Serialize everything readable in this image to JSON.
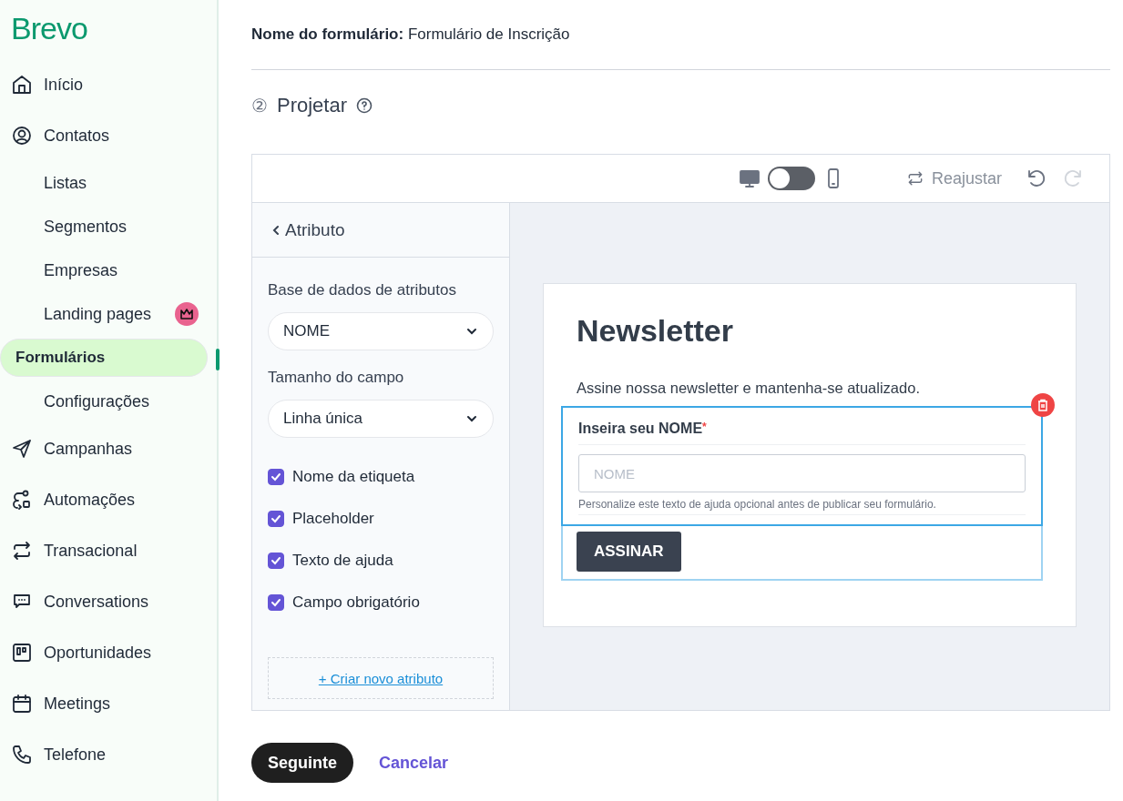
{
  "sidebar": {
    "logo": "Brevo",
    "items": [
      {
        "label": "Início",
        "kind": "home",
        "selected": false
      },
      {
        "label": "Contatos",
        "kind": "contact",
        "selected": false,
        "children": [
          {
            "label": "Listas",
            "selected": false,
            "premium": false
          },
          {
            "label": "Segmentos",
            "selected": false,
            "premium": false
          },
          {
            "label": "Empresas",
            "selected": false,
            "premium": false
          },
          {
            "label": "Landing pages",
            "selected": false,
            "premium": true
          },
          {
            "label": "Formulários",
            "selected": true,
            "premium": false
          },
          {
            "label": "Configurações",
            "selected": false,
            "premium": false
          }
        ]
      },
      {
        "label": "Campanhas",
        "kind": "send",
        "selected": false
      },
      {
        "label": "Automações",
        "kind": "automation",
        "selected": false
      },
      {
        "label": "Transacional",
        "kind": "transfer",
        "selected": false
      },
      {
        "label": "Conversations",
        "kind": "chat",
        "selected": false
      },
      {
        "label": "Oportunidades",
        "kind": "board",
        "selected": false
      },
      {
        "label": "Meetings",
        "kind": "calendar",
        "selected": false
      },
      {
        "label": "Telefone",
        "kind": "phone",
        "selected": false
      }
    ]
  },
  "header": {
    "form_name_label": "Nome do formulário:",
    "form_name": "Formulário de Inscrição"
  },
  "step": {
    "number": "②",
    "title": "Projetar"
  },
  "toolbar": {
    "view_toggle_on": false,
    "reset": "Reajustar",
    "undo_disabled": false,
    "redo_disabled": true
  },
  "panel": {
    "back": "Atributo",
    "database_label": "Base de dados de atributos",
    "database_value": "NOME",
    "size_label": "Tamanho do campo",
    "size_value": "Linha única",
    "options": [
      {
        "label": "Nome da etiqueta",
        "checked": true
      },
      {
        "label": "Placeholder",
        "checked": true
      },
      {
        "label": "Texto de ajuda",
        "checked": true
      },
      {
        "label": "Campo obrigatório",
        "checked": true
      }
    ],
    "create_link": "+ Criar novo atributo"
  },
  "preview": {
    "title": "Newsletter",
    "description": "Assine nossa newsletter e mantenha-se atualizado.",
    "field_label": "Inseira seu NOME",
    "required_mark": "*",
    "placeholder": "NOME",
    "help": "Personalize este texto de ajuda opcional antes de publicar seu formulário.",
    "button": "ASSINAR"
  },
  "footer": {
    "next": "Seguinte",
    "cancel": "Cancelar"
  }
}
